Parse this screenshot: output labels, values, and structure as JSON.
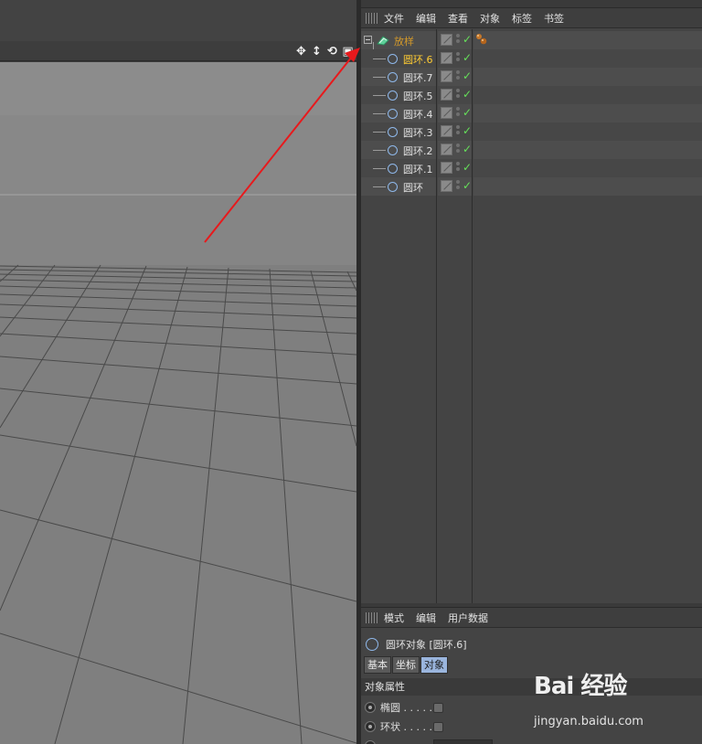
{
  "object_manager": {
    "menu": [
      "文件",
      "编辑",
      "查看",
      "对象",
      "标签",
      "书签"
    ],
    "parent": {
      "label": "放样"
    },
    "children": [
      {
        "label": "圆环.6",
        "active": true
      },
      {
        "label": "圆环.7",
        "active": false
      },
      {
        "label": "圆环.5",
        "active": false
      },
      {
        "label": "圆环.4",
        "active": false
      },
      {
        "label": "圆环.3",
        "active": false
      },
      {
        "label": "圆环.2",
        "active": false
      },
      {
        "label": "圆环.1",
        "active": false
      },
      {
        "label": "圆环",
        "active": false
      }
    ]
  },
  "attribute_manager": {
    "menu": [
      "模式",
      "编辑",
      "用户数据"
    ],
    "title": "圆环对象 [圆环.6]",
    "tabs": [
      {
        "label": "基本",
        "active": false
      },
      {
        "label": "坐标",
        "active": false
      },
      {
        "label": "对象",
        "active": true
      }
    ],
    "section": "对象属性",
    "props": [
      {
        "label": "椭圆 . . . . ."
      },
      {
        "label": "环状 . . . . ."
      }
    ]
  },
  "watermark": {
    "brand": "Bai 经验",
    "url": "jingyan.baidu.com"
  },
  "colors": {
    "accent_active": "#ffcc33",
    "parent_label": "#d59a2a",
    "check": "#66e05a",
    "annotation_arrow": "#e8191c",
    "object_icon": "#8fb8ea"
  }
}
